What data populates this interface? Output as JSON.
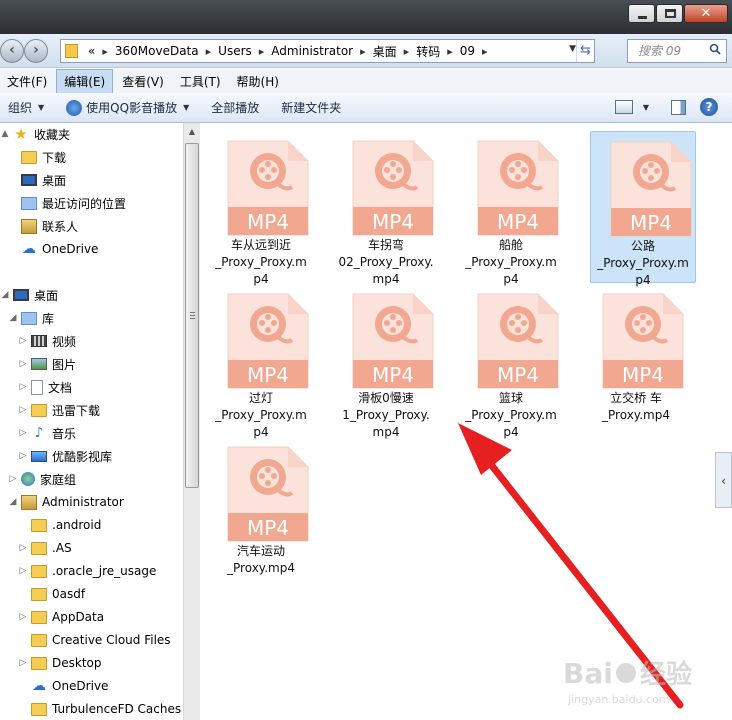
{
  "address": {
    "crumbs": [
      "360MoveData",
      "Users",
      "Administrator",
      "桌面",
      "转码",
      "09"
    ],
    "overflow_glyph": "«"
  },
  "search": {
    "placeholder": "搜索 09"
  },
  "window_buttons": {
    "close_glyph": "✕"
  },
  "menu": [
    {
      "label": "文件(F)",
      "active": false
    },
    {
      "label": "编辑(E)",
      "active": true
    },
    {
      "label": "查看(V)",
      "active": false
    },
    {
      "label": "工具(T)",
      "active": false
    },
    {
      "label": "帮助(H)",
      "active": false
    }
  ],
  "toolbar": {
    "organize": "组织",
    "play_qq": "使用QQ影音播放",
    "play_all": "全部播放",
    "new_folder": "新建文件夹",
    "help": "?"
  },
  "nav": [
    {
      "label": "收藏夹",
      "icon": "favorites-star-icon",
      "indent": 0,
      "exp": "▲"
    },
    {
      "label": "下载",
      "icon": "downloads-folder-icon",
      "indent": 1,
      "exp": ""
    },
    {
      "label": "桌面",
      "icon": "desktop-icon",
      "indent": 1,
      "exp": ""
    },
    {
      "label": "最近访问的位置",
      "icon": "recent-places-icon",
      "indent": 1,
      "exp": ""
    },
    {
      "label": "联系人",
      "icon": "contacts-icon",
      "indent": 1,
      "exp": ""
    },
    {
      "label": "OneDrive",
      "icon": "onedrive-cloud-icon",
      "indent": 1,
      "exp": ""
    },
    {
      "label": "桌面",
      "icon": "desktop-icon",
      "indent": 0,
      "exp": "◢"
    },
    {
      "label": "库",
      "icon": "library-folder-icon",
      "indent": 1,
      "exp": "◢"
    },
    {
      "label": "视频",
      "icon": "video-library-icon",
      "indent": 2,
      "exp": "▷"
    },
    {
      "label": "图片",
      "icon": "pictures-library-icon",
      "indent": 2,
      "exp": "▷"
    },
    {
      "label": "文档",
      "icon": "documents-library-icon",
      "indent": 2,
      "exp": "▷"
    },
    {
      "label": "迅雷下载",
      "icon": "thunder-download-folder-icon",
      "indent": 2,
      "exp": "▷"
    },
    {
      "label": "音乐",
      "icon": "music-library-icon",
      "indent": 2,
      "exp": "▷"
    },
    {
      "label": "优酷影视库",
      "icon": "youku-library-icon",
      "indent": 2,
      "exp": "▷"
    },
    {
      "label": "家庭组",
      "icon": "homegroup-icon",
      "indent": 1,
      "exp": "▷"
    },
    {
      "label": "Administrator",
      "icon": "user-folder-icon",
      "indent": 1,
      "exp": "◢"
    },
    {
      "label": ".android",
      "icon": "folder-icon",
      "indent": 2,
      "exp": ""
    },
    {
      "label": ".AS",
      "icon": "folder-icon",
      "indent": 2,
      "exp": "▷"
    },
    {
      "label": ".oracle_jre_usage",
      "icon": "folder-icon",
      "indent": 2,
      "exp": "▷"
    },
    {
      "label": "0asdf",
      "icon": "folder-icon",
      "indent": 2,
      "exp": ""
    },
    {
      "label": "AppData",
      "icon": "folder-icon",
      "indent": 2,
      "exp": "▷"
    },
    {
      "label": "Creative Cloud Files",
      "icon": "folder-icon",
      "indent": 2,
      "exp": ""
    },
    {
      "label": "Desktop",
      "icon": "folder-icon",
      "indent": 2,
      "exp": "▷"
    },
    {
      "label": "OneDrive",
      "icon": "onedrive-cloud-icon",
      "indent": 2,
      "exp": ""
    },
    {
      "label": "TurbulenceFD Caches (",
      "icon": "folder-icon",
      "indent": 2,
      "exp": ""
    }
  ],
  "files": [
    {
      "name": "车从远到近\n_Proxy_Proxy.m\np4",
      "badge": "MP4",
      "selected": false
    },
    {
      "name": "车拐弯\n02_Proxy_Proxy.\nmp4",
      "badge": "MP4",
      "selected": false
    },
    {
      "name": "船舱\n_Proxy_Proxy.m\np4",
      "badge": "MP4",
      "selected": false
    },
    {
      "name": "公路\n_Proxy_Proxy.m\np4",
      "badge": "MP4",
      "selected": true
    },
    {
      "name": "过灯\n_Proxy_Proxy.m\np4",
      "badge": "MP4",
      "selected": false
    },
    {
      "name": "滑板0慢速\n1_Proxy_Proxy.\nmp4",
      "badge": "MP4",
      "selected": false
    },
    {
      "name": "篮球\n_Proxy_Proxy.m\np4",
      "badge": "MP4",
      "selected": false
    },
    {
      "name": "立交桥 车\n_Proxy.mp4",
      "badge": "MP4",
      "selected": false
    },
    {
      "name": "汽车运动\n_Proxy.mp4",
      "badge": "MP4",
      "selected": false
    }
  ],
  "colors": {
    "file_icon_bg": "#fbe3dc",
    "file_icon_accent": "#f2a791",
    "arrow": "#e62020",
    "selection": "#cce4f7"
  },
  "watermark": {
    "brand": "Bai",
    "brand2": "经验",
    "url": "jingyan.baidu.com"
  }
}
